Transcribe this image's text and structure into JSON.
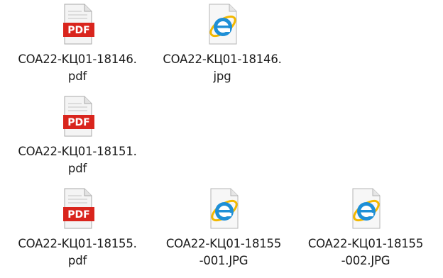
{
  "files": [
    {
      "type": "pdf",
      "icon": "pdf-file-icon",
      "badge": "PDF",
      "name_line1": "COA22-KЦ01-18146.",
      "name_line2": "pdf"
    },
    {
      "type": "jpg",
      "icon": "internet-explorer-file-icon",
      "name_line1": "COA22-KЦ01-18146.",
      "name_line2": "jpg"
    },
    {
      "type": "pdf",
      "icon": "pdf-file-icon",
      "badge": "PDF",
      "name_line1": "COA22-KЦ01-18151.",
      "name_line2": "pdf"
    },
    {
      "type": "pdf",
      "icon": "pdf-file-icon",
      "badge": "PDF",
      "name_line1": "COA22-KЦ01-18155.",
      "name_line2": "pdf"
    },
    {
      "type": "jpg",
      "icon": "internet-explorer-file-icon",
      "name_line1": "COA22-KЦ01-18155",
      "name_line2": "-001.JPG"
    },
    {
      "type": "jpg",
      "icon": "internet-explorer-file-icon",
      "name_line1": "COA22-KЦ01-18155",
      "name_line2": "-002.JPG"
    }
  ],
  "colors": {
    "pdf_badge": "#d9251d",
    "ie_blue": "#1e8fd6",
    "ie_ring": "#f2b800"
  }
}
